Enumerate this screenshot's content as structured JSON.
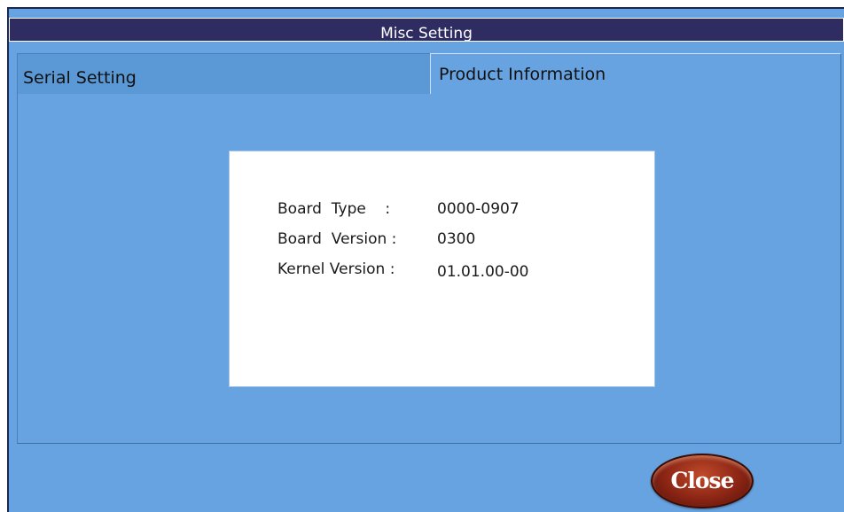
{
  "window": {
    "title": "Misc Setting"
  },
  "tabs": [
    {
      "label": "Serial Setting",
      "active": false
    },
    {
      "label": "Product Information",
      "active": true
    }
  ],
  "product_info": {
    "rows": [
      {
        "label": "Board  Type    :",
        "value": "0000-0907"
      },
      {
        "label": "Board  Version :",
        "value": "0300"
      },
      {
        "label": "Kernel Version :",
        "value": "01.01.00-00"
      }
    ]
  },
  "buttons": {
    "close_label": "Close"
  },
  "colors": {
    "background": "#67a3e0",
    "titlebar": "#2e2c61",
    "inactive_tab": "#5b98d6",
    "close_button": "#8a2414"
  }
}
